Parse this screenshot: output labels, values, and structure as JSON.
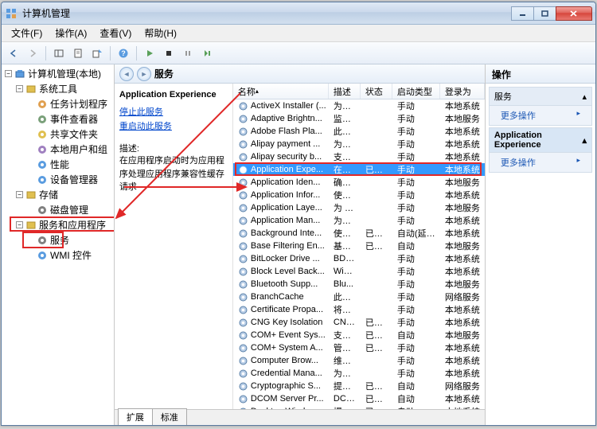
{
  "title": "计算机管理",
  "menus": [
    "文件(F)",
    "操作(A)",
    "查看(V)",
    "帮助(H)"
  ],
  "tree": {
    "root": "计算机管理(本地)",
    "groups": [
      {
        "label": "系统工具",
        "open": true,
        "children": [
          {
            "label": "任务计划程序",
            "icon": "clock"
          },
          {
            "label": "事件查看器",
            "icon": "event"
          },
          {
            "label": "共享文件夹",
            "icon": "folder"
          },
          {
            "label": "本地用户和组",
            "icon": "users"
          },
          {
            "label": "性能",
            "icon": "perf"
          },
          {
            "label": "设备管理器",
            "icon": "device"
          }
        ]
      },
      {
        "label": "存储",
        "open": true,
        "children": [
          {
            "label": "磁盘管理",
            "icon": "disk"
          }
        ]
      },
      {
        "label": "服务和应用程序",
        "open": true,
        "boxed": true,
        "children": [
          {
            "label": "服务",
            "icon": "gear",
            "boxed": true
          },
          {
            "label": "WMI 控件",
            "icon": "wmi"
          }
        ]
      }
    ]
  },
  "center": {
    "title": "服务",
    "detail": {
      "heading": "Application Experience",
      "link1": "停止此服务",
      "link2": "重启动此服务",
      "descLabel": "描述:",
      "desc": "在应用程序启动时为应用程序处理应用程序兼容性缓存请求"
    },
    "columns": [
      "名称",
      "描述",
      "状态",
      "启动类型",
      "登录为"
    ],
    "rows": [
      {
        "n": "ActiveX Installer (...",
        "d": "为从...",
        "s": "",
        "t": "手动",
        "l": "本地系统"
      },
      {
        "n": "Adaptive Brightn...",
        "d": "监视...",
        "s": "",
        "t": "手动",
        "l": "本地服务"
      },
      {
        "n": "Adobe Flash Pla...",
        "d": "此服...",
        "s": "",
        "t": "手动",
        "l": "本地系统"
      },
      {
        "n": "Alipay payment ...",
        "d": "为支...",
        "s": "",
        "t": "手动",
        "l": "本地系统"
      },
      {
        "n": "Alipay security b...",
        "d": "支付...",
        "s": "",
        "t": "手动",
        "l": "本地系统"
      },
      {
        "n": "Application Expe...",
        "d": "在应...",
        "s": "已启动",
        "t": "手动",
        "l": "本地系统",
        "sel": true,
        "boxed": true
      },
      {
        "n": "Application Iden...",
        "d": "确定...",
        "s": "",
        "t": "手动",
        "l": "本地服务"
      },
      {
        "n": "Application Infor...",
        "d": "使用...",
        "s": "",
        "t": "手动",
        "l": "本地系统"
      },
      {
        "n": "Application Laye...",
        "d": "为 In...",
        "s": "",
        "t": "手动",
        "l": "本地服务"
      },
      {
        "n": "Application Man...",
        "d": "为通...",
        "s": "",
        "t": "手动",
        "l": "本地系统"
      },
      {
        "n": "Background Inte...",
        "d": "使用...",
        "s": "已启动",
        "t": "自动(延迟...",
        "l": "本地系统"
      },
      {
        "n": "Base Filtering En...",
        "d": "基本...",
        "s": "已启动",
        "t": "自动",
        "l": "本地服务"
      },
      {
        "n": "BitLocker Drive ...",
        "d": "BDE...",
        "s": "",
        "t": "手动",
        "l": "本地系统"
      },
      {
        "n": "Block Level Back...",
        "d": "Win...",
        "s": "",
        "t": "手动",
        "l": "本地系统"
      },
      {
        "n": "Bluetooth Supp...",
        "d": "Blu...",
        "s": "",
        "t": "手动",
        "l": "本地服务"
      },
      {
        "n": "BranchCache",
        "d": "此服...",
        "s": "",
        "t": "手动",
        "l": "网络服务"
      },
      {
        "n": "Certificate Propa...",
        "d": "将用...",
        "s": "",
        "t": "手动",
        "l": "本地系统"
      },
      {
        "n": "CNG Key Isolation",
        "d": "CNG...",
        "s": "已启动",
        "t": "手动",
        "l": "本地系统"
      },
      {
        "n": "COM+ Event Sys...",
        "d": "支持...",
        "s": "已启动",
        "t": "自动",
        "l": "本地服务"
      },
      {
        "n": "COM+ System A...",
        "d": "管理...",
        "s": "已启动",
        "t": "手动",
        "l": "本地系统"
      },
      {
        "n": "Computer Brow...",
        "d": "维护...",
        "s": "",
        "t": "手动",
        "l": "本地系统"
      },
      {
        "n": "Credential Mana...",
        "d": "为用...",
        "s": "",
        "t": "手动",
        "l": "本地系统"
      },
      {
        "n": "Cryptographic S...",
        "d": "提供...",
        "s": "已启动",
        "t": "自动",
        "l": "网络服务"
      },
      {
        "n": "DCOM Server Pr...",
        "d": "DCO...",
        "s": "已启动",
        "t": "自动",
        "l": "本地系统"
      },
      {
        "n": "Desktop Windo...",
        "d": "提供...",
        "s": "已启动",
        "t": "自动",
        "l": "本地系统"
      }
    ],
    "tabs": [
      "扩展",
      "标准"
    ]
  },
  "right": {
    "header": "操作",
    "sections": [
      {
        "title": "服务",
        "items": [
          "更多操作"
        ]
      },
      {
        "title": "Application Experience",
        "blue": true,
        "items": [
          "更多操作"
        ]
      }
    ]
  }
}
